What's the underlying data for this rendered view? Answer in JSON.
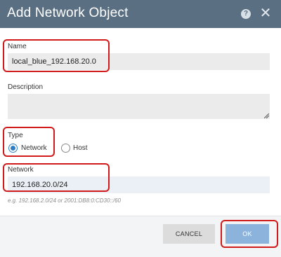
{
  "dialog": {
    "title": "Add Network Object",
    "help_icon": "?",
    "close_icon": "✕"
  },
  "name": {
    "label": "Name",
    "value": "local_blue_192.168.20.0"
  },
  "description": {
    "label": "Description",
    "value": ""
  },
  "type": {
    "label": "Type",
    "options": [
      {
        "label": "Network",
        "selected": true
      },
      {
        "label": "Host",
        "selected": false
      }
    ]
  },
  "network": {
    "label": "Network",
    "value": "192.168.20.0/24",
    "hint": "e.g. 192.168.2.0/24 or 2001:DB8:0:CD30::/60"
  },
  "buttons": {
    "cancel": "CANCEL",
    "ok": "OK"
  },
  "colors": {
    "header": "#5a6f82",
    "accent": "#2d7fc1",
    "ok_button": "#8bb3db",
    "highlight": "#d11a1a"
  }
}
